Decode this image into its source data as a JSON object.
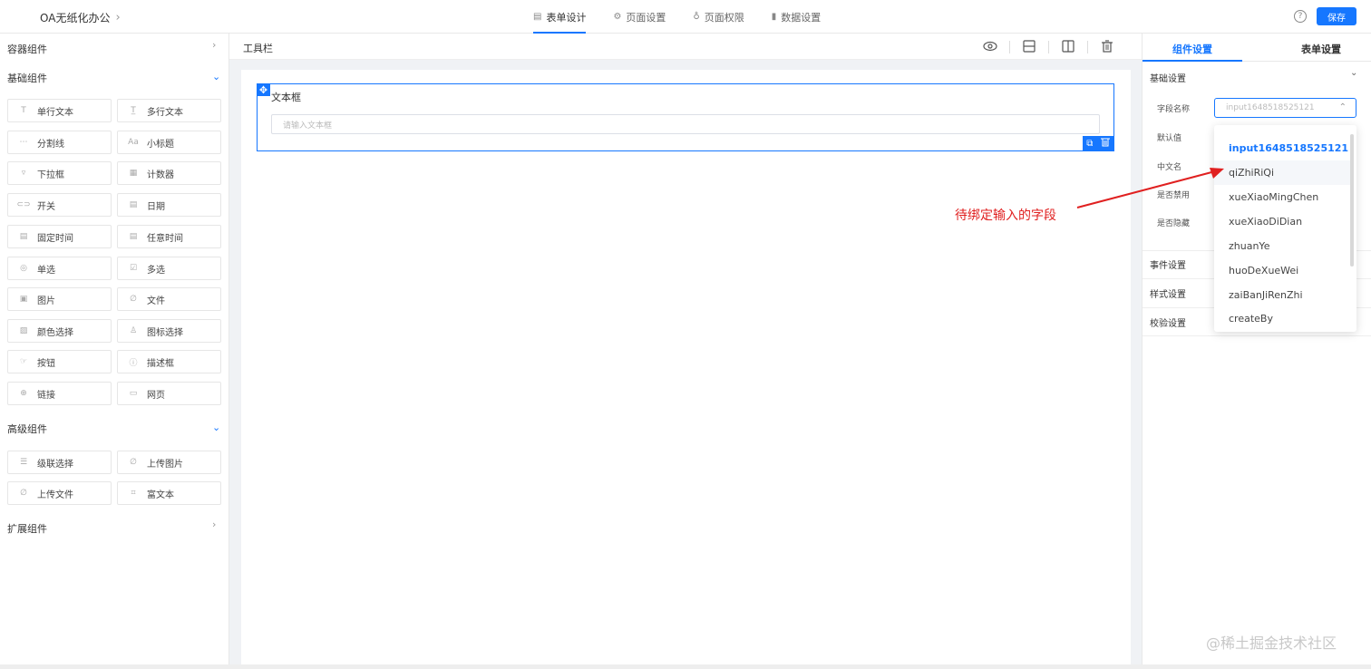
{
  "header": {
    "app_title": "OA无纸化办公",
    "tabs": [
      {
        "label": "表单设计",
        "icon": "file-icon",
        "active": true
      },
      {
        "label": "页面设置",
        "icon": "gear-icon",
        "active": false
      },
      {
        "label": "页面权限",
        "icon": "lock-icon",
        "active": false
      },
      {
        "label": "数据设置",
        "icon": "bar-chart-icon",
        "active": false
      }
    ],
    "save_label": "保存",
    "accent_color": "#1677ff"
  },
  "sidebar": {
    "sections": {
      "container": "容器组件",
      "basic": "基础组件",
      "advanced": "高级组件",
      "extended": "扩展组件"
    },
    "basic_components": [
      {
        "label": "单行文本",
        "icon": "text-icon"
      },
      {
        "label": "多行文本",
        "icon": "textarea-icon"
      },
      {
        "label": "分割线",
        "icon": "divider-icon"
      },
      {
        "label": "小标题",
        "icon": "subtitle-icon"
      },
      {
        "label": "下拉框",
        "icon": "dropdown-icon"
      },
      {
        "label": "计数器",
        "icon": "counter-icon"
      },
      {
        "label": "开关",
        "icon": "switch-icon"
      },
      {
        "label": "日期",
        "icon": "calendar-icon"
      },
      {
        "label": "固定时间",
        "icon": "calendar-icon"
      },
      {
        "label": "任意时间",
        "icon": "calendar-icon"
      },
      {
        "label": "单选",
        "icon": "radio-icon"
      },
      {
        "label": "多选",
        "icon": "checkbox-icon"
      },
      {
        "label": "图片",
        "icon": "image-icon"
      },
      {
        "label": "文件",
        "icon": "paperclip-icon"
      },
      {
        "label": "颜色选择",
        "icon": "color-icon"
      },
      {
        "label": "图标选择",
        "icon": "person-icon"
      },
      {
        "label": "按钮",
        "icon": "button-icon"
      },
      {
        "label": "描述框",
        "icon": "info-icon"
      },
      {
        "label": "链接",
        "icon": "globe-icon"
      },
      {
        "label": "网页",
        "icon": "webpage-icon"
      }
    ],
    "advanced_components": [
      {
        "label": "级联选择",
        "icon": "cascade-icon"
      },
      {
        "label": "上传图片",
        "icon": "paperclip-icon"
      },
      {
        "label": "上传文件",
        "icon": "paperclip-icon"
      },
      {
        "label": "富文本",
        "icon": "richtext-icon"
      }
    ]
  },
  "toolbar": {
    "label": "工具栏"
  },
  "canvas": {
    "field_label": "文本框",
    "field_placeholder": "请输入文本框"
  },
  "right_panel": {
    "tabs": [
      "组件设置",
      "表单设置"
    ],
    "groups": {
      "basic": "基础设置",
      "event": "事件设置",
      "style": "样式设置",
      "validate": "校验设置"
    },
    "props": {
      "field_name": "字段名称",
      "default_value": "默认值",
      "chinese_name": "中文名",
      "disabled": "是否禁用",
      "hidden": "是否隐藏"
    },
    "select_value": "input1648518525121",
    "dropdown_options": [
      "input1648518525121",
      "qiZhiRiQi",
      "xueXiaoMingChen",
      "xueXiaoDiDian",
      "zhuanYe",
      "huoDeXueWei",
      "zaiBanJiRenZhi",
      "createBy"
    ]
  },
  "annotation": "待绑定输入的字段",
  "watermark": "@稀土掘金技术社区"
}
